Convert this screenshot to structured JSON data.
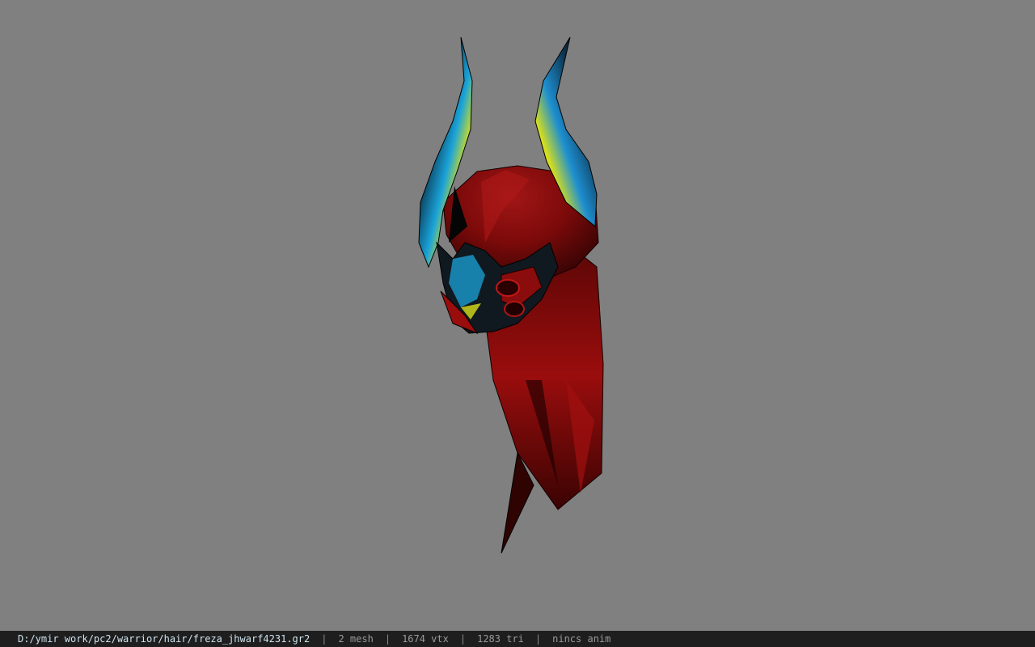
{
  "viewport": {
    "background_color": "#808080",
    "model": {
      "icon": "demon-helmet-model",
      "primary_color": "#8b0a0a",
      "horn_accent_colors": [
        "#1aa3d9",
        "#d9e01a",
        "#0a0a0a"
      ]
    }
  },
  "statusbar": {
    "file_path": "D:/ymir work/pc2/warrior/hair/freza_jhwarf4231.gr2",
    "separator": "|",
    "mesh_count": "2 mesh",
    "vertex_count": "1674 vtx",
    "triangle_count": "1283 tri",
    "anim_status": "nincs anim",
    "background_color": "#1e1e1e"
  }
}
